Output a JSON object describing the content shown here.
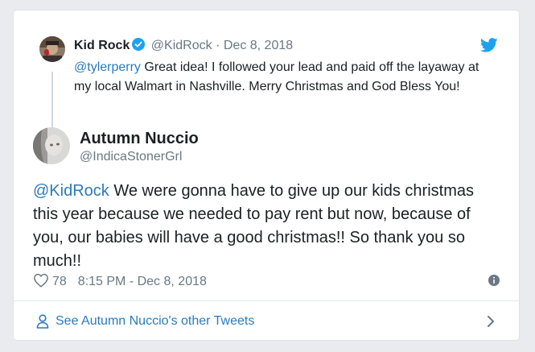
{
  "parent_tweet": {
    "name": "Kid Rock",
    "handle": "@KidRock",
    "separator": "·",
    "date": "Dec 8, 2018",
    "mention": "@tylerperry",
    "text": " Great idea! I followed your lead and paid off the layaway at my local Walmart in Nashville.  Merry Christmas and God Bless You!"
  },
  "tweet": {
    "name": "Autumn Nuccio",
    "handle": "@IndicaStonerGrl",
    "mention": "@KidRock",
    "text": " We were gonna have to give up our kids christmas this year because we needed to pay rent but now, because of you, our babies will have a good christmas!! So thank you so much!!",
    "likes": "78",
    "timestamp": "8:15 PM - Dec 8, 2018"
  },
  "footer": {
    "see_more_label": "See Autumn Nuccio's other Tweets"
  },
  "icons": {
    "brand": "twitter-bird-icon",
    "verified": "verified-badge-icon",
    "like": "heart-icon",
    "info": "info-icon",
    "profile": "person-icon",
    "more": "chevron-right-icon"
  },
  "colors": {
    "link": "#2b7bb9",
    "brand": "#1da1f2",
    "muted": "#697882",
    "text": "#1c2022"
  }
}
